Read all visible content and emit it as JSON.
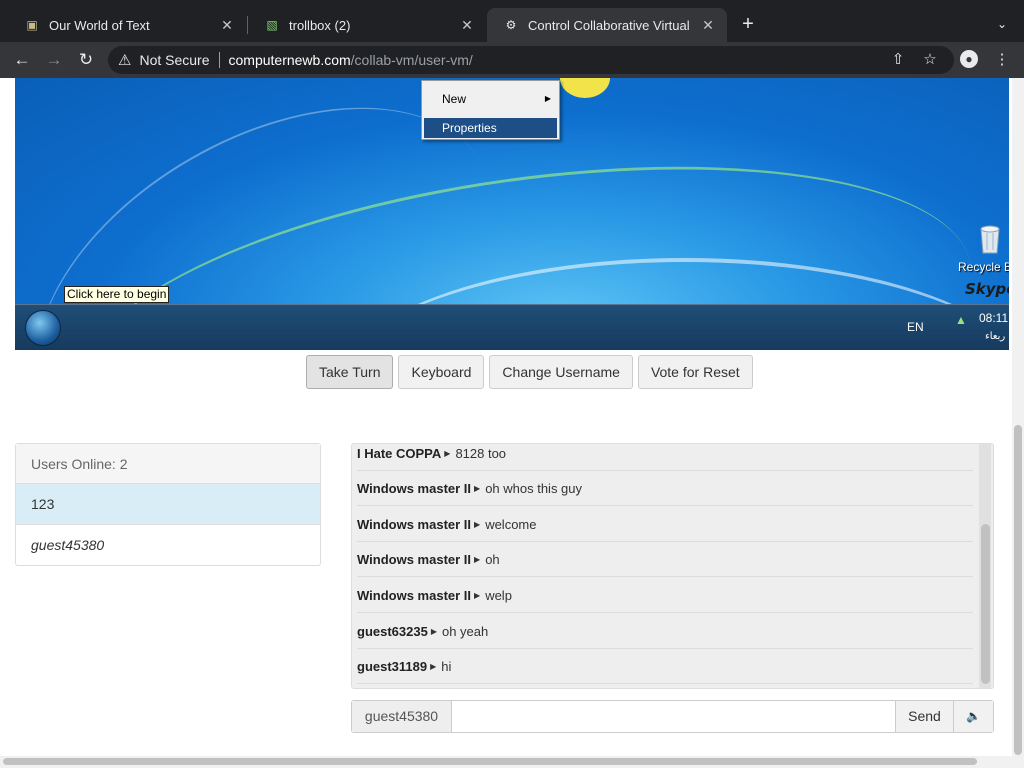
{
  "browser": {
    "tabs": [
      {
        "title": "Our World of Text",
        "icon": "globe-icon"
      },
      {
        "title": "trollbox (2)",
        "icon": "trollbox-icon"
      },
      {
        "title": "Control Collaborative Virtual M",
        "icon": "vm-icon"
      }
    ],
    "security_label": "Not Secure",
    "url_host": "computernewb.com",
    "url_path": "/collab-vm/user-vm/"
  },
  "vm": {
    "context_menu": {
      "items": [
        "New",
        "Properties"
      ],
      "selected": "Properties"
    },
    "tooltip": "Click here to begin",
    "desktop_icons": [
      {
        "label": "Recycle B"
      },
      {
        "label": "Skype"
      }
    ],
    "tray": {
      "language": "EN",
      "time": "08:11",
      "date_fragment": "ربعاء"
    }
  },
  "controls": {
    "take_turn": "Take Turn",
    "keyboard": "Keyboard",
    "change_username": "Change Username",
    "vote_reset": "Vote for Reset"
  },
  "users": {
    "header": "Users Online: 2",
    "list": [
      "123",
      "guest45380"
    ]
  },
  "chat": {
    "messages": [
      {
        "user": "I Hate COPPA",
        "text": "8128 too"
      },
      {
        "user": "Windows master II",
        "text": "oh whos this guy"
      },
      {
        "user": "Windows master II",
        "text": "welcome"
      },
      {
        "user": "Windows master II",
        "text": "oh"
      },
      {
        "user": "Windows master II",
        "text": "welp"
      },
      {
        "user": "guest63235",
        "text": "oh yeah"
      },
      {
        "user": "guest31189",
        "text": "hi"
      }
    ],
    "username": "guest45380",
    "input_value": "",
    "send_label": "Send"
  }
}
